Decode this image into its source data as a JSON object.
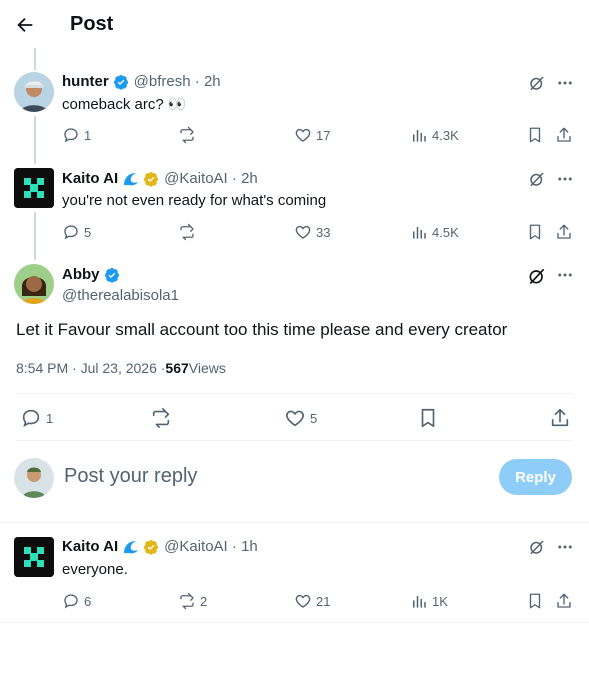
{
  "header": {
    "title": "Post"
  },
  "replies_above": [
    {
      "name": "hunter",
      "handle": "@bfresh",
      "time": "2h",
      "text": "comeback arc? 👀",
      "stats": {
        "replies": "1",
        "reposts": "",
        "likes": "17",
        "views": "4.3K"
      }
    },
    {
      "name": "Kaito AI",
      "handle": "@KaitoAI",
      "time": "2h",
      "text": "you're not even ready for what's coming",
      "stats": {
        "replies": "5",
        "reposts": "",
        "likes": "33",
        "views": "4.5K"
      }
    }
  ],
  "main_post": {
    "name": "Abby",
    "handle": "@therealabisola1",
    "text": "Let it Favour small account too this time please and every creator",
    "time": "8:54 PM · Jul 23, 2026 · ",
    "views_count": "567",
    "views_label": " Views",
    "stats": {
      "replies": "1",
      "reposts": "",
      "likes": "5"
    }
  },
  "composer": {
    "placeholder": "Post your reply",
    "button": "Reply"
  },
  "reply_below": {
    "name": "Kaito AI",
    "handle": "@KaitoAI",
    "time": "1h",
    "text": "everyone.",
    "stats": {
      "replies": "6",
      "reposts": "2",
      "likes": "21",
      "views": "1K"
    }
  },
  "colors": {
    "verified_blue": "#1d9bf0",
    "verified_gold": "#e2b719",
    "kaito_green": "#2de0b9",
    "reply_button": "#8ecdf8"
  }
}
